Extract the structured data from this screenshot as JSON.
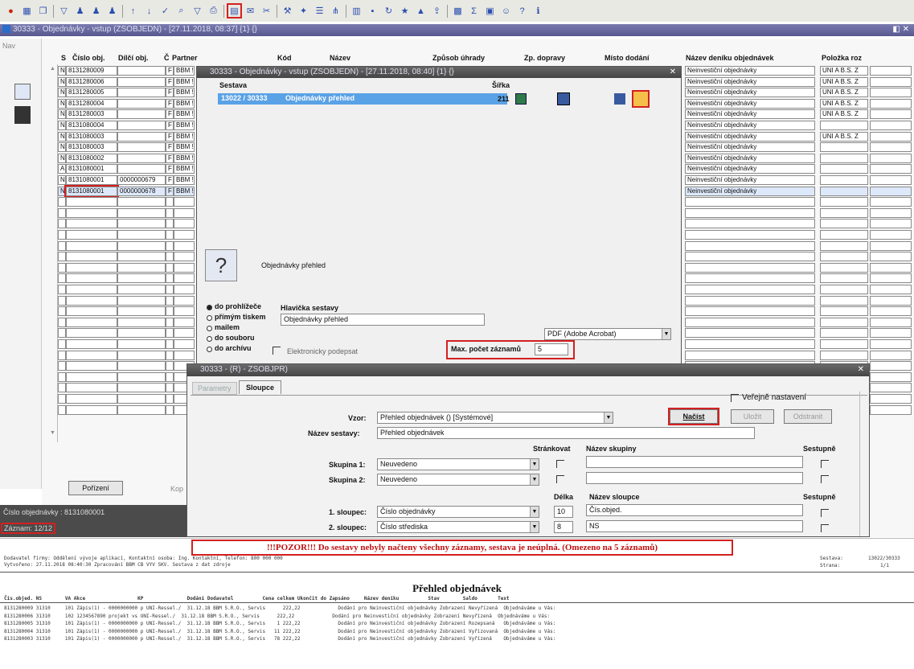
{
  "toolbar_icons": [
    "record-icon",
    "grid-icon",
    "copy-icon",
    "filter-icon",
    "user-icon",
    "user-icon",
    "user-icon",
    "sort-asc-icon",
    "sort-desc-icon",
    "check-icon",
    "search-icon",
    "filter-icon",
    "print-icon",
    "report-icon",
    "mail-icon",
    "cut-icon",
    "tool-icon",
    "wizard-icon",
    "list-icon",
    "tree-icon",
    "chart-icon",
    "save-icon",
    "refresh-icon",
    "star-icon",
    "warning-icon",
    "export-icon",
    "table-icon",
    "sum-icon",
    "grid2-icon",
    "user2-icon",
    "help-icon",
    "info-icon"
  ],
  "main_title": "30333 - Objednávky - vstup (ZSOBJEDN) - [27.11.2018, 08:37] {1} {}",
  "nav_label": "Nav",
  "table": {
    "headers": [
      "S",
      "Číslo obj.",
      "Dílčí obj.",
      "Č",
      "Partner",
      "Kód",
      "Název",
      "Způsob úhrady",
      "Zp. dopravy",
      "Místo dodání",
      "Název deníku objednávek",
      "Položka roz"
    ],
    "rows": [
      {
        "s": "N",
        "cislo": "8131280009",
        "dilci": "",
        "c": "F",
        "partner": "BBM !",
        "denik": "Neinvestiční objednávky",
        "polozka": "UNI A B.S. Z"
      },
      {
        "s": "N",
        "cislo": "8131280006",
        "dilci": "",
        "c": "F",
        "partner": "BBM !",
        "denik": "Neinvestiční objednávky",
        "polozka": "UNI A B.S. Z"
      },
      {
        "s": "N",
        "cislo": "8131280005",
        "dilci": "",
        "c": "F",
        "partner": "BBM !",
        "denik": "Neinvestiční objednávky",
        "polozka": "UNI A B.S. Z"
      },
      {
        "s": "N",
        "cislo": "8131280004",
        "dilci": "",
        "c": "F",
        "partner": "BBM !",
        "denik": "Neinvestiční objednávky",
        "polozka": "UNI A B.S. Z"
      },
      {
        "s": "N",
        "cislo": "8131280003",
        "dilci": "",
        "c": "F",
        "partner": "BBM !",
        "denik": "Neinvestiční objednávky",
        "polozka": "UNI A B.S. Z"
      },
      {
        "s": "N",
        "cislo": "8131080004",
        "dilci": "",
        "c": "F",
        "partner": "BBM !",
        "denik": "Neinvestiční objednávky",
        "polozka": ""
      },
      {
        "s": "N",
        "cislo": "8131080003",
        "dilci": "",
        "c": "F",
        "partner": "BBM !",
        "denik": "Neinvestiční objednávky",
        "polozka": "UNI A B.S. Z"
      },
      {
        "s": "N",
        "cislo": "8131080003",
        "dilci": "",
        "c": "F",
        "partner": "BBM !",
        "denik": "Neinvestiční objednávky",
        "polozka": ""
      },
      {
        "s": "N",
        "cislo": "8131080002",
        "dilci": "",
        "c": "F",
        "partner": "BBM !",
        "denik": "Neinvestiční objednávky",
        "polozka": ""
      },
      {
        "s": "A",
        "cislo": "8131080001",
        "dilci": "",
        "c": "F",
        "partner": "BBM !",
        "denik": "Neinvestiční objednávky",
        "polozka": ""
      },
      {
        "s": "N",
        "cislo": "8131080001",
        "dilci": "0000000679",
        "c": "F",
        "partner": "BBM !",
        "denik": "Neinvestiční objednávky",
        "polozka": ""
      },
      {
        "s": "N",
        "cislo": "8131080001",
        "dilci": "0000000678",
        "c": "F",
        "partner": "BBM !",
        "denik": "Neinvestiční objednávky",
        "polozka": ""
      }
    ]
  },
  "porizeni_label": "Pořízení",
  "kop_label": "Kop",
  "status1": "Číslo objednávky : 8131080001",
  "status2": "Záznam: 12/12",
  "dlg1": {
    "title": "30333 - Objednávky - vstup (ZSOBJEDN) - [27.11.2018, 08:40] {1} {}",
    "col_sestava": "Sestava",
    "col_sirka": "Šířka",
    "row_code": "13022 / 30333",
    "row_name": "Objednávky přehled",
    "row_sirka": "211",
    "report_name": "Objednávky přehled",
    "radios": [
      "do prohlížeče",
      "přímým tiskem",
      "mailem",
      "do souboru",
      "do archívu"
    ],
    "hlavicka_label": "Hlavička sestavy",
    "hlavicka_value": "Objednávky přehled",
    "format_value": "PDF (Adobe Acrobat)",
    "podepsat_label": "Elektronicky podepsat",
    "max_label": "Max. počet záznamů",
    "max_value": "5"
  },
  "dlg2": {
    "title": "30333 - (R) - ZSOBJPR)",
    "tabs": [
      "Parametry",
      "Sloupce"
    ],
    "verejne_label": "Veřejně nastavení",
    "vzor_label": "Vzor:",
    "vzor_value": "Přehled objednávek () [Systémové]",
    "nacist": "Načíst",
    "ulozit": "Uložit",
    "odstranit": "Odstranit",
    "nazev_sestavy_label": "Název sestavy:",
    "nazev_sestavy_value": "Přehled objednávek",
    "strankovat_label": "Stránkovat",
    "nazev_skupiny_label": "Název skupiny",
    "sestupne_label": "Sestupně",
    "skupina1_label": "Skupina 1:",
    "skupina1_value": "Neuvedeno",
    "skupina2_label": "Skupina 2:",
    "skupina2_value": "Neuvedeno",
    "delka_label": "Délka",
    "nazev_sloupce_label": "Název sloupce",
    "sestupne2_label": "Sestupně",
    "sloupec1_label": "1. sloupec:",
    "sloupec1_value": "Číslo objednávky",
    "sloupec1_delka": "10",
    "sloupec1_nazev": "Čís.objed.",
    "sloupec2_label": "2. sloupec:",
    "sloupec2_value": "Číslo střediska",
    "sloupec2_delka": "8",
    "sloupec2_nazev": "NS"
  },
  "warning": "!!!POZOR!!! Do sestavy nebyly načteny všechny záznamy, sestava je neúplná. (Omezeno na 5 záznamů)",
  "report": {
    "header1": "Dodavatel firmy: Oddělení vývoje aplikací, Kontaktní osoba: Ing. Kontaktní, Telefon: 800 000 000",
    "header2": "Vytvořeno: 27.11.2018 08:40:30 Zpracování BBM CB VYV SKV. Sestava z dat zdroje",
    "sestava_label": "Sestava:",
    "sestava_value": "13022/30333",
    "strana_label": "Strana:",
    "strana_value": "1/1",
    "title": "Přehled objednávek",
    "col_line": "Čís.objed. NS        VA Akce                  KP               Dodání Dodavatel          Cena celkem Ukončit do Zapsáno     Název deníku          Stav        Saldo       Text",
    "lines": [
      "8131280009 31310     101 Zápis(1) - 0000000000 p UNI-Ressel./  31.12.18 BBM S.R.O., Servis      222,22             Dodání pro Neinvestiční objednávky Zobrazení Nevyřízená  Objednáváme u Vás:",
      "8131280006 31310     102 1234567890 projekt vs UNI-Ressel./  31.12.18 BBM S.R.O., Servis      222,22             Dodání pro Neinvestiční objednávky Zobrazení Nevyřízená  Objednáváme u Vás:",
      "8131280005 31310     101 Zápis(1) - 0000000000 p UNI-Ressel./  31.12.18 BBM S.R.O., Servis    1 222,22             Dodání pro Neinvestiční objednávky Zobrazení Rozepsaná   Objednáváme u Vás:",
      "8131280004 31310     101 Zápis(1) - 0000000000 p UNI-Ressel./  31.12.18 BBM S.R.O., Servis   11 222,22             Dodání pro Neinvestiční objednávky Zobrazení Vyřizovaná  Objednáváme u Vás:",
      "8131280003 31310     101 Zápis(1) - 0000000000 p UNI-Ressel./  31.12.18 BBM S.R.O., Servis   78 222,22             Dodání pro Neinvestiční objednávky Zobrazení Vyřízená    Objednáváme u Vás:"
    ]
  }
}
